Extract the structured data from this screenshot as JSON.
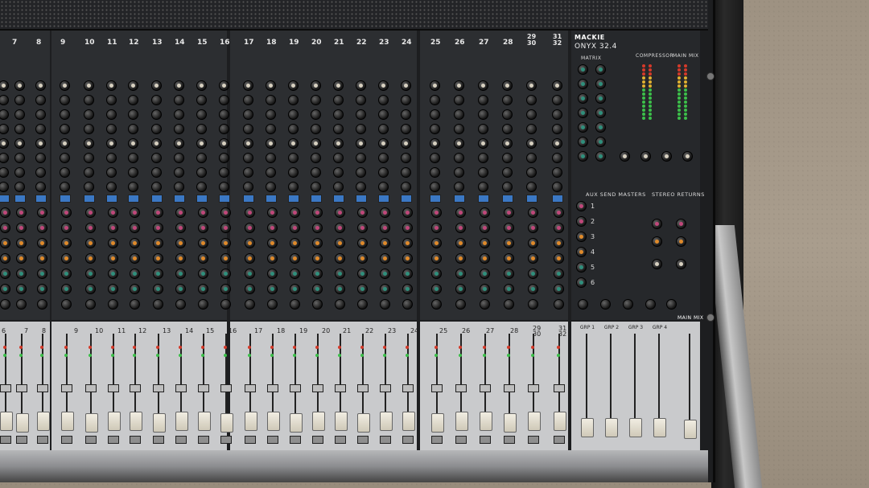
{
  "brand": "MACKIE",
  "model": "ONYX 32.4",
  "channel_numbers_top": [
    "7",
    "8",
    "9",
    "10",
    "11",
    "12",
    "13",
    "14",
    "15",
    "16",
    "17",
    "18",
    "19",
    "20",
    "21",
    "22",
    "23",
    "24",
    "25",
    "26",
    "27",
    "28",
    "29 30",
    "31 32"
  ],
  "channel_numbers_fader": [
    "6",
    "7",
    "8",
    "9",
    "10",
    "11",
    "12",
    "13",
    "14",
    "15",
    "16",
    "17",
    "18",
    "19",
    "20",
    "21",
    "22",
    "23",
    "24",
    "25",
    "26",
    "27",
    "28",
    "29 30",
    "31 32"
  ],
  "master_labels": {
    "matrix": "MATRIX",
    "compressor": "COMPRESSOR",
    "main_mix_top": "MAIN MIX",
    "aux_send_masters": "AUX SEND MASTERS",
    "stereo_returns": "STEREO RETURNS",
    "main_mix": "MAIN MIX",
    "grp": [
      "GRP 1",
      "GRP 2",
      "GRP 3",
      "GRP 4"
    ],
    "aux_numbers": [
      "1",
      "2",
      "3",
      "4",
      "5",
      "6"
    ]
  },
  "colors": {
    "knob_pink": "#c0477a",
    "knob_orange": "#e08a2a",
    "knob_teal": "#2f8f7c",
    "knob_gray": "#9aa0a6",
    "led_red": "#d43a2a",
    "led_green": "#3cbf4a",
    "button_blue": "#3b78c4"
  }
}
